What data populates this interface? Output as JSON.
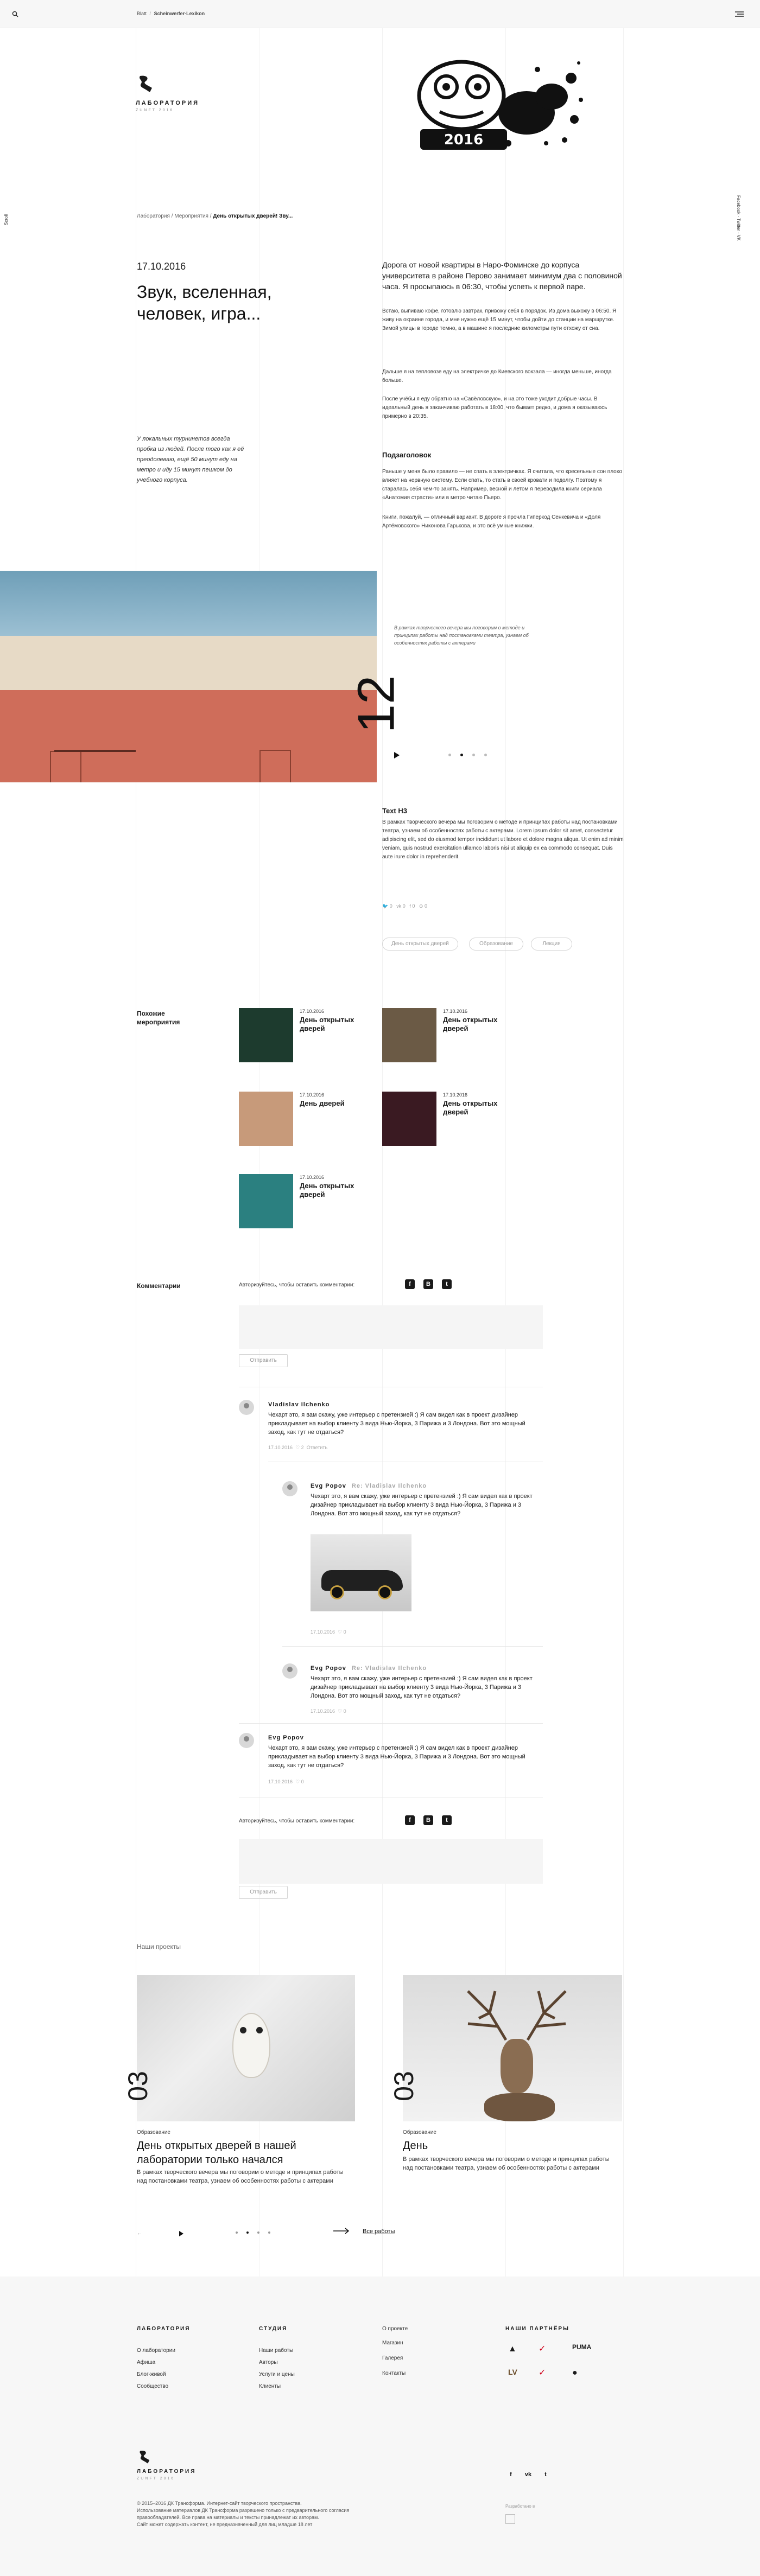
{
  "header": {
    "breadcrumb_home": "Blatt",
    "breadcrumb_current": "Scheinwerfer-Lexikon"
  },
  "logo": {
    "name": "ЛАБОРАТОРИЯ",
    "tagline": "ZUNFT 2016"
  },
  "side": {
    "left_label": "Scroll",
    "right_label": "Facebook · Twitter · VK"
  },
  "breadcrumbs": {
    "items": [
      "Лаборатория",
      "Мероприятия"
    ],
    "current": "День открытых дверей! Зву..."
  },
  "article": {
    "date": "17.10.2016",
    "title": "Звук, вселенная, человек, игра...",
    "lead": "Дорога от новой квартиры в Наро-Фоминске до корпуса университета в районе Перово занимает минимум два с половиной часа. Я просыпаюсь в 06:30, чтобы успеть к первой паре.",
    "paragraphs": [
      "Встаю, выпиваю кофе, готовлю завтрак, привожу себя в порядок. Из дома выхожу в 06:50. Я живу на окраине города, и мне нужно ещё 15 минут, чтобы дойти до станции на маршрутке. Зимой улицы в городе темно, а в машине я последние километры пути отхожу от сна.",
      "Дальше я на тепловозе еду на электричке до Киевского вокзала — иногда меньше, иногда больше.",
      "После учёбы я еду обратно на «Савёловскую», и на это тоже уходит добрые часы. В идеальный день я заканчиваю работать в 18:00, что бывает редко, и дома я оказываюсь примерно в 20:35."
    ],
    "side_quote": "У локальных турнинетов всегда пробка из людей. После того как я её преодолеваю, ещё 50 минут еду на метро и иду 15 минут пешком до учебного корпуса.",
    "subheading": "Подзаголовок",
    "sub_paragraphs": [
      "Раньше у меня было правило — не спать в электричках. Я считала, что кресельные сон плохо влияет на нервную систему. Если спать, то стать в своей кровати и подолгу. Поэтому я старалась себя чем-то занять. Например, весной и летом я переводила книги сериала «Анатомия страсти» или в метро читаю Пьеро.",
      "Книги, пожалуй, — отличный вариант. В дороге я прочла Гиперкод Сенкевича и «Доля Артёмовского» Никонова Гарькова, и это всё умные книжки."
    ],
    "gallery": {
      "number": "12",
      "caption": "В рамках творческого вечера мы поговорим о методе и принципах работы над постановками театра, узнаем об особенностях работы с актерами"
    },
    "h3": "Text H3",
    "h3_text": "В рамках творческого вечера мы поговорим о методе и принципах работы над постановками театра, узнаем об особенностях работы с актерами. Lorem ipsum dolor sit amet, consectetur adipiscing elit, sed do eiusmod tempor incididunt ut labore et dolore magna aliqua. Ut enim ad minim veniam, quis nostrud exercitation ullamco laboris nisi ut aliquip ex ea commodo consequat. Duis aute irure dolor in reprehenderit.",
    "share": {
      "twitter": "0",
      "vk": "0",
      "fb": "0",
      "ok": "0"
    },
    "tags": [
      "День открытых дверей",
      "Образование",
      "Лекция"
    ]
  },
  "related": {
    "title": "Похожие мероприятия",
    "items": [
      {
        "date": "17.10.2016",
        "title": "День открытых дверей",
        "color": "#1d3b2e"
      },
      {
        "date": "17.10.2016",
        "title": "День открытых дверей",
        "color": "#6b5a45"
      },
      {
        "date": "17.10.2016",
        "title": "День дверей",
        "color": "#c79a7a"
      },
      {
        "date": "17.10.2016",
        "title": "День открытых дверей",
        "color": "#3a1a22"
      },
      {
        "date": "17.10.2016",
        "title": "День открытых дверей",
        "color": "#2b8080"
      }
    ]
  },
  "comments": {
    "title": "Комментарии",
    "auth_prompt": "Авторизуйтесь, чтобы оставить комментарии:",
    "submit": "Отправить",
    "list": [
      {
        "author": "Vladislav Ilchenko",
        "reply_to": "",
        "text": "Чехарт это, я вам скажу, уже интерьер с претензией :) Я сам видел как в проект дизайнер прикладывает на выбор клиенту 3 вида Нью-Йорка, 3 Парижа и 3 Лондона. Вот это мощный заход, как тут не отдаться?",
        "date": "17.10.2016",
        "likes": "2",
        "action": "Ответить"
      },
      {
        "author": "Evg Popov",
        "reply_to": "Re: Vladislav Ilchenko",
        "text": "Чехарт это, я вам скажу, уже интерьер с претензией :) Я сам видел как в проект дизайнер прикладывает на выбор клиенту 3 вида Нью-Йорка, 3 Парижа и 3 Лондона. Вот это мощный заход, как тут не отдаться?",
        "date": "17.10.2016",
        "likes": "0",
        "action": ""
      },
      {
        "author": "Evg Popov",
        "reply_to": "Re: Vladislav Ilchenko",
        "text": "Чехарт это, я вам скажу, уже интерьер с претензией :) Я сам видел как в проект дизайнер прикладывает на выбор клиенту 3 вида Нью-Йорка, 3 Парижа и 3 Лондона. Вот это мощный заход, как тут не отдаться?",
        "date": "17.10.2016",
        "likes": "0",
        "action": ""
      },
      {
        "author": "Evg Popov",
        "reply_to": "",
        "text": "Чехарт это, я вам скажу, уже интерьер с претензией :) Я сам видел как в проект дизайнер прикладывает на выбор клиенту 3 вида Нью-Йорка, 3 Парижа и 3 Лондона. Вот это мощный заход, как тут не отдаться?",
        "date": "17.10.2016",
        "likes": "0",
        "action": ""
      }
    ]
  },
  "projects": {
    "title": "Наши проекты",
    "items": [
      {
        "num": "03",
        "category": "Образование",
        "title": "День открытых дверей в нашей лаборатории только начался",
        "text": "В рамках творческого вечера мы поговорим о методе и принципах работы над постановками театра, узнаем об особенностях работы с актерами"
      },
      {
        "num": "03",
        "category": "Образование",
        "title": "День",
        "text": "В рамках творческого вечера мы поговорим о методе и принципах работы над постановками театра, узнаем об особенностях работы с актерами"
      }
    ],
    "all_link": "Все работы"
  },
  "footer": {
    "col1_title": "ЛАБОРАТОРИЯ",
    "col1": [
      "О лаборатории",
      "Афиша",
      "Блог-живой",
      "Сообщество"
    ],
    "col2_title": "СТУДИЯ",
    "col2": [
      "Наши работы",
      "Авторы",
      "Услуги и цены",
      "Клиенты"
    ],
    "col3_title": "",
    "col3": [
      "О проекте",
      "Магазин",
      "Галерея",
      "Контакты"
    ],
    "partners_title": "НАШИ ПАРТНЁРЫ",
    "partners": [
      "Adidas",
      "Nike",
      "Puma",
      "Louis Vuitton",
      "Nike",
      "Apple"
    ],
    "copyright": "© 2015–2016 ДК Трансформа. Интернет-сайт творческого пространства.",
    "copyright2": "Использование материалов ДК Трансформа разрешено только с предварительного согласия правообладателей. Все права на материалы и тексты принадлежат их авторам.",
    "copyright3": "Сайт может содержать контент, не предназначенный для лиц младше 18 лет",
    "made_by": "Разработано в"
  }
}
